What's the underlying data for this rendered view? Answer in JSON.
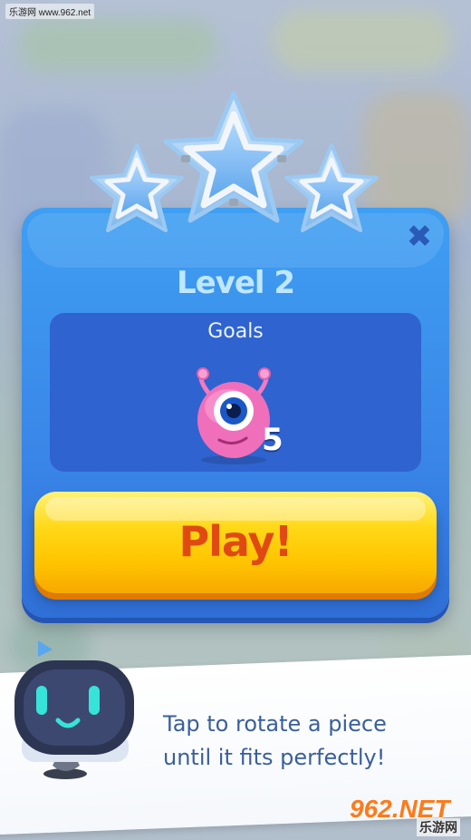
{
  "watermark_top": "乐游网 www.962.net",
  "level": {
    "title": "Level 2"
  },
  "goals": {
    "label": "Goals",
    "target_icon": "pink-monster-icon",
    "count": "5"
  },
  "play_button": {
    "label": "Play!"
  },
  "close": {
    "label": "✖"
  },
  "stars": {
    "earned": 0,
    "total": 3
  },
  "tip": {
    "line1": "Tap to rotate a piece",
    "line2": "until it fits perfectly!",
    "mascot": "robot-mascot-icon"
  },
  "watermark_bottom": {
    "main": "962.NET",
    "sub": "乐游网"
  },
  "colors": {
    "panel": "#3a86e8",
    "goals_box": "#2f63cf",
    "play": "#ffc400",
    "play_text": "#e04a12",
    "tip_text": "#3a5f9a"
  }
}
